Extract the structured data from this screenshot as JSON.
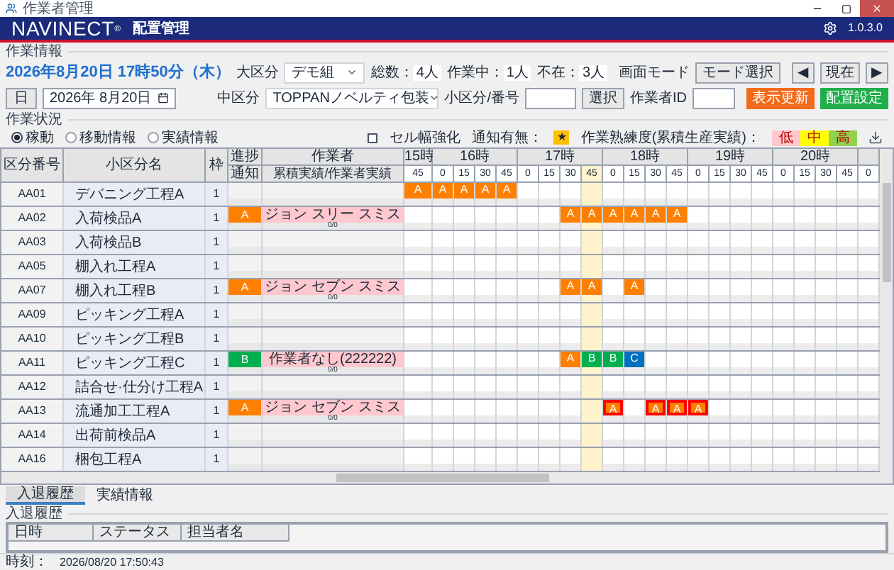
{
  "window": {
    "title": "作業者管理"
  },
  "header": {
    "logo": "NAVINECT",
    "logo_mark": "®",
    "subtitle": "配置管理",
    "version": "1.0.3.0"
  },
  "info": {
    "legend": "作業情報",
    "datetime": "2026年8月20日 17時50分（木）",
    "day_button": "日",
    "date_picker": "2026年 8月20日",
    "major": {
      "label": "大区分",
      "value": "デモ組"
    },
    "middle": {
      "label": "中区分",
      "value": "TOPPANノベルティ包装"
    },
    "counts": [
      {
        "label": "総数：",
        "value": "4人"
      },
      {
        "label": "作業中：",
        "value": "1人"
      },
      {
        "label": "不在：",
        "value": "3人"
      }
    ],
    "mode_label": "画面モード",
    "mode_button": "モード選択",
    "nav": [
      "◀",
      "現在",
      "▶"
    ],
    "small_label": "小区分/番号",
    "select_button": "選択",
    "worker_id_label": "作業者ID",
    "actions": [
      {
        "label": "表示更新",
        "kind": "refresh"
      },
      {
        "label": "配置設定",
        "kind": "assign"
      }
    ]
  },
  "status": {
    "legend": "作業状況",
    "radios": [
      {
        "label": "稼動",
        "selected": true
      },
      {
        "label": "移動情報",
        "selected": false
      },
      {
        "label": "実績情報",
        "selected": false
      }
    ],
    "checkbox": {
      "label": "セル幅強化",
      "checked": false
    },
    "notify_label": "通知有無：",
    "notify_mark": "★",
    "skill_label": "作業熟練度(累積生産実績)：",
    "skill_levels": [
      {
        "label": "低",
        "color": "#ffc7ce"
      },
      {
        "label": "中",
        "color": "#ffff00"
      },
      {
        "label": "高",
        "color": "#92d050"
      }
    ]
  },
  "grid": {
    "columns": [
      "区分番号",
      "小区分名",
      "枠",
      "進捗",
      "作業者"
    ],
    "sub_columns": [
      "通知",
      "累積実績/作業者実績"
    ],
    "hours": [
      {
        "label": "15時",
        "slots": [
          {
            "label": "45",
            "current": false
          }
        ]
      },
      {
        "label": "16時",
        "slots": [
          {
            "label": "0",
            "current": false
          },
          {
            "label": "15",
            "current": false
          },
          {
            "label": "30",
            "current": false
          },
          {
            "label": "45",
            "current": false
          }
        ]
      },
      {
        "label": "17時",
        "slots": [
          {
            "label": "0",
            "current": false
          },
          {
            "label": "15",
            "current": false
          },
          {
            "label": "30",
            "current": false
          },
          {
            "label": "45",
            "current": true
          }
        ]
      },
      {
        "label": "18時",
        "slots": [
          {
            "label": "0",
            "current": false
          },
          {
            "label": "15",
            "current": false
          },
          {
            "label": "30",
            "current": false
          },
          {
            "label": "45",
            "current": false
          }
        ]
      },
      {
        "label": "19時",
        "slots": [
          {
            "label": "0",
            "current": false
          },
          {
            "label": "15",
            "current": false
          },
          {
            "label": "30",
            "current": false
          },
          {
            "label": "45",
            "current": false
          }
        ]
      },
      {
        "label": "20時",
        "slots": [
          {
            "label": "0",
            "current": false
          },
          {
            "label": "15",
            "current": false
          },
          {
            "label": "30",
            "current": false
          },
          {
            "label": "45",
            "current": false
          }
        ]
      },
      {
        "slots": [
          {
            "label": "0",
            "current": false
          }
        ]
      }
    ],
    "rows": [
      {
        "code": "AA01",
        "name": "デバニング工程A",
        "frame": "1",
        "cells": [
          {
            "label": "A",
            "color": "#ff8000",
            "alert": false
          },
          {
            "label": "A",
            "color": "#ff8000",
            "alert": false
          },
          {
            "label": "A",
            "color": "#ff8000",
            "alert": false
          },
          {
            "label": "A",
            "color": "#ff8000",
            "alert": false
          },
          {
            "label": "A",
            "color": "#ff8000",
            "alert": false
          }
        ]
      },
      {
        "code": "AA02",
        "name": "入荷検品A",
        "frame": "1",
        "progress": {
          "label": "A",
          "color": "#ff8000"
        },
        "worker": {
          "name": "ジョン スリー スミス",
          "color": "#ffc7ce"
        },
        "result": "0/0",
        "cells": [
          null,
          null,
          null,
          null,
          null,
          null,
          null,
          {
            "label": "A",
            "color": "#ff8000",
            "alert": false
          },
          {
            "label": "A",
            "color": "#ff8000",
            "alert": false
          },
          {
            "label": "A",
            "color": "#ff8000",
            "alert": false
          },
          {
            "label": "A",
            "color": "#ff8000",
            "alert": false
          },
          {
            "label": "A",
            "color": "#ff8000",
            "alert": false
          },
          {
            "label": "A",
            "color": "#ff8000",
            "alert": false
          }
        ]
      },
      {
        "code": "AA03",
        "name": "入荷検品B",
        "frame": "1",
        "cells": []
      },
      {
        "code": "AA05",
        "name": "棚入れ工程A",
        "frame": "1",
        "cells": []
      },
      {
        "code": "AA07",
        "name": "棚入れ工程B",
        "frame": "1",
        "progress": {
          "label": "A",
          "color": "#ff8000"
        },
        "worker": {
          "name": "ジョン セブン スミス",
          "color": "#ffc7ce"
        },
        "result": "0/0",
        "cells": [
          null,
          null,
          null,
          null,
          null,
          null,
          null,
          {
            "label": "A",
            "color": "#ff8000",
            "alert": false
          },
          {
            "label": "A",
            "color": "#ff8000",
            "alert": false
          },
          null,
          {
            "label": "A",
            "color": "#ff8000",
            "alert": false
          }
        ]
      },
      {
        "code": "AA09",
        "name": "ピッキング工程A",
        "frame": "1",
        "cells": []
      },
      {
        "code": "AA10",
        "name": "ピッキング工程B",
        "frame": "1",
        "cells": []
      },
      {
        "code": "AA11",
        "name": "ピッキング工程C",
        "frame": "1",
        "progress": {
          "label": "B",
          "color": "#00b050"
        },
        "worker": {
          "name": "作業者なし(222222)",
          "color": "#ffc7ce"
        },
        "result": "0/0",
        "cells": [
          null,
          null,
          null,
          null,
          null,
          null,
          null,
          {
            "label": "A",
            "color": "#ff8000",
            "alert": false
          },
          {
            "label": "B",
            "color": "#00b050",
            "alert": false
          },
          {
            "label": "B",
            "color": "#00b050",
            "alert": false
          },
          {
            "label": "C",
            "color": "#0070c0",
            "alert": false
          }
        ]
      },
      {
        "code": "AA12",
        "name": "詰合せ·仕分け工程A",
        "frame": "1",
        "cells": []
      },
      {
        "code": "AA13",
        "name": "流通加工工程A",
        "frame": "1",
        "progress": {
          "label": "A",
          "color": "#ff8000"
        },
        "worker": {
          "name": "ジョン セブン スミス",
          "color": "#ffc7ce"
        },
        "result": "0/0",
        "cells": [
          null,
          null,
          null,
          null,
          null,
          null,
          null,
          null,
          null,
          {
            "label": "A",
            "color": "#ff8000",
            "alert": true
          },
          null,
          {
            "label": "A",
            "color": "#ff8000",
            "alert": true
          },
          {
            "label": "A",
            "color": "#ff8000",
            "alert": true
          },
          {
            "label": "A",
            "color": "#ff8000",
            "alert": true
          }
        ]
      },
      {
        "code": "AA14",
        "name": "出荷前検品A",
        "frame": "1",
        "cells": []
      },
      {
        "code": "AA16",
        "name": "梱包工程A",
        "frame": "1",
        "cells": []
      }
    ]
  },
  "bottom": {
    "tabs": [
      {
        "label": "入退履歴",
        "selected": true
      },
      {
        "label": "実績情報",
        "selected": false
      }
    ],
    "legend": "入退履歴",
    "columns": [
      "日時",
      "ステータス",
      "担当者名"
    ]
  },
  "status_bar": {
    "label": "時刻：",
    "value": "2026/08/20 17:50:43"
  }
}
